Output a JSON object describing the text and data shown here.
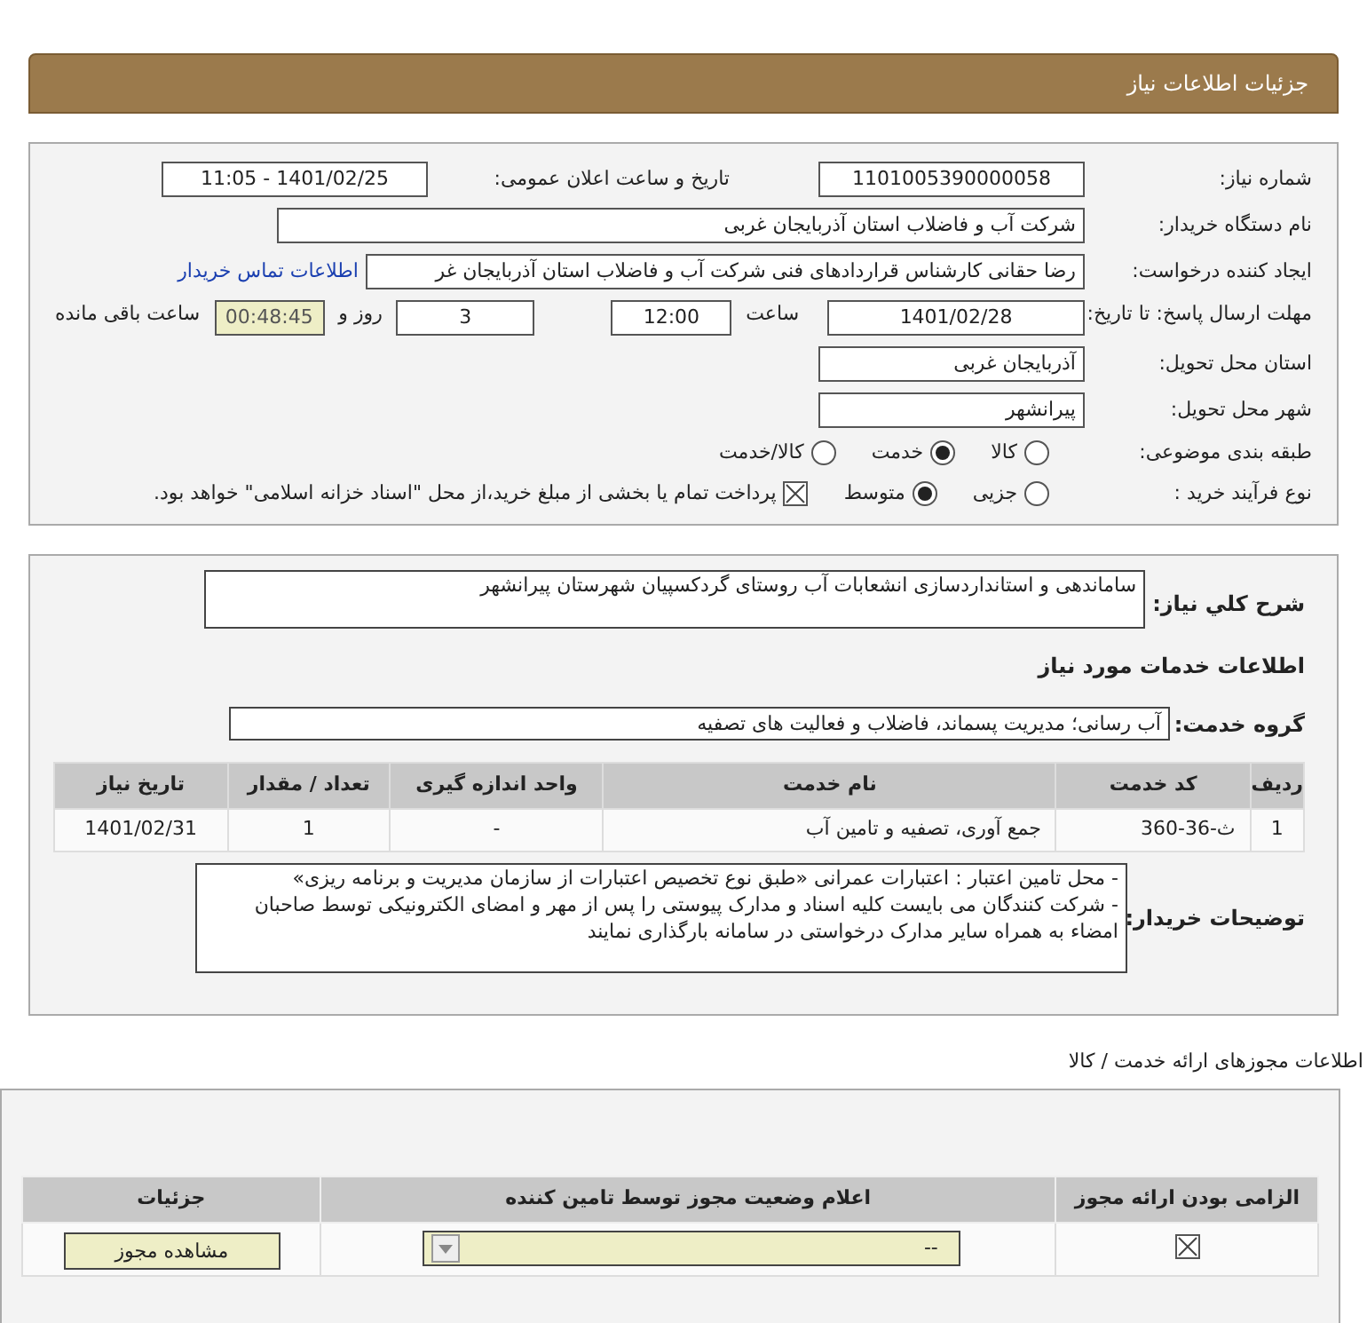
{
  "header": {
    "title": "جزئیات اطلاعات نیاز"
  },
  "need_number": {
    "label": "شماره نیاز:",
    "value": "1101005390000058"
  },
  "announce": {
    "label": "تاریخ و ساعت اعلان عمومی:",
    "value": "1401/02/25 - 11:05"
  },
  "buyer": {
    "label": "نام دستگاه خریدار:",
    "value": "شرکت آب و فاضلاب استان آذربایجان غربی"
  },
  "creator": {
    "label": "ایجاد کننده درخواست:",
    "value": "رضا حقانی کارشناس قراردادهای فنی شرکت آب و فاضلاب استان آذربایجان غر",
    "link": "اطلاعات تماس خریدار"
  },
  "deadline": {
    "label": "مهلت ارسال پاسخ: تا تاریخ:",
    "date": "1401/02/28",
    "time_label": "ساعت",
    "time": "12:00",
    "days": "3",
    "days_label": "روز و",
    "remaining": "00:48:45",
    "remaining_label": "ساعت باقی مانده"
  },
  "province": {
    "label": "استان محل تحویل:",
    "value": "آذربایجان غربی"
  },
  "city": {
    "label": "شهر محل تحویل:",
    "value": "پیرانشهر"
  },
  "category": {
    "label": "طبقه بندی موضوعی:",
    "options": [
      {
        "label": "کالا",
        "selected": false
      },
      {
        "label": "خدمت",
        "selected": true
      },
      {
        "label": "کالا/خدمت",
        "selected": false
      }
    ]
  },
  "process": {
    "label": "نوع فرآیند خرید :",
    "options": [
      {
        "label": "جزیی",
        "selected": false
      },
      {
        "label": "متوسط",
        "selected": true
      }
    ],
    "treasury": {
      "label": "پرداخت تمام یا بخشی از مبلغ خرید،از محل \"اسناد خزانه اسلامی\" خواهد بود.",
      "checked": true
    }
  },
  "summary": {
    "label": "شرح کلي نياز:",
    "value": "ساماندهی و استانداردسازی انشعابات آب روستای گردکسپیان شهرستان پیرانشهر"
  },
  "services_title": "اطلاعات خدمات مورد نیاز",
  "service_group": {
    "label": "گروه خدمت:",
    "value": "آب رسانی؛ مدیریت پسماند، فاضلاب و فعالیت های تصفیه"
  },
  "table": {
    "columns": [
      "ردیف",
      "کد خدمت",
      "نام خدمت",
      "واحد اندازه گیری",
      "تعداد / مقدار",
      "تاریخ نیاز"
    ],
    "rows": [
      [
        "1",
        "ث-36-360",
        "جمع آوری، تصفیه و تامین آب",
        "-",
        "1",
        "1401/02/31"
      ]
    ]
  },
  "notes": {
    "label": "توضیحات خریدار:",
    "items": [
      "-  محل تامین اعتبار : اعتبارات عمرانی «طبق نوع تخصیص اعتبارات از سازمان مدیریت و برنامه ریزی»",
      "-  شرکت کنندگان می بایست کلیه اسناد و مدارک پیوستی را پس از مهر و امضای الکترونیکی توسط صاحبان امضاء به همراه سایر مدارک درخواستی در سامانه بارگذاری نمایند"
    ]
  },
  "licenses_title": "اطلاعات مجوزهای ارائه خدمت / کالا",
  "licenses": {
    "columns": [
      "الزامی بودن ارائه مجوز",
      "اعلام وضعیت مجوز توسط تامین کننده",
      "جزئیات"
    ],
    "rows": [
      {
        "required": true,
        "status": "--",
        "button": "مشاهده مجوز"
      }
    ]
  }
}
